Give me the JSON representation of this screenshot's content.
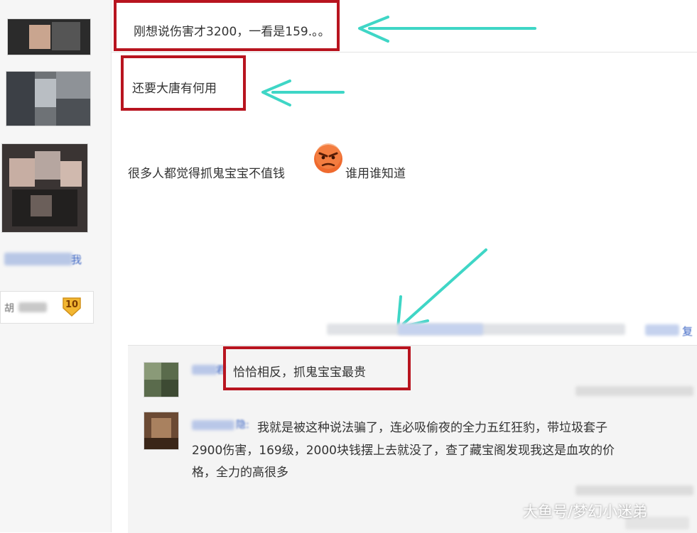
{
  "posts": [
    {
      "text": "刚想说伤害才3200，一看是159.。。"
    },
    {
      "text": "还要大唐有何用"
    },
    {
      "text_before_emoji": "很多人都觉得抓鬼宝宝不值钱",
      "text_after_emoji": "谁用谁知道"
    }
  ],
  "left_profile": {
    "level": "10",
    "name_partial": "胡",
    "link_text_partial": "我"
  },
  "reply_bar": {
    "reply_link_tail": "复"
  },
  "replies": [
    {
      "user_partial": "君",
      "text": "恰恰相反，抓鬼宝宝最贵"
    },
    {
      "user_partial": "隐:",
      "text_lines": [
        "我就是被这种说法骗了，连必吸偷夜的全力五红狂豹，带垃圾套子",
        "2900伤害，169级，2000块钱摆上去就没了，查了藏宝阁发现我这是血攻的价",
        "格，全力的高很多"
      ]
    }
  ],
  "watermark": "大鱼号/梦幻小迷弟",
  "colors": {
    "highlight_box": "#b8141f",
    "arrow": "#3fd6c6",
    "link": "#3d66c4"
  },
  "icons": [
    "angry-face-emoji-icon",
    "level-badge-icon"
  ]
}
